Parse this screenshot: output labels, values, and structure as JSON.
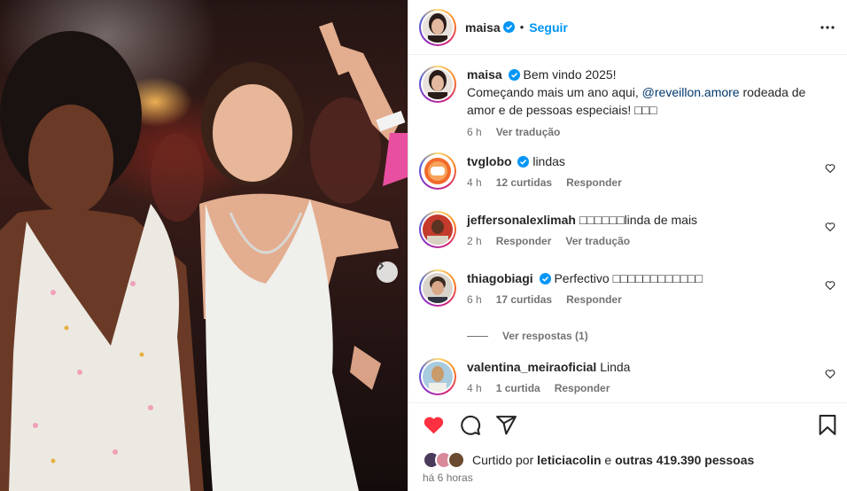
{
  "header": {
    "username": "maisa",
    "separator": "•",
    "follow_label": "Seguir"
  },
  "caption": {
    "username": "maisa",
    "line1": "Bem vindo 2025!",
    "line2_prefix": "Começando mais um ano aqui, ",
    "mention": "@reveillon.amore",
    "line2_suffix": " rodeada de amor e de pessoas especiais! □□□",
    "time": "6 h",
    "translate": "Ver tradução"
  },
  "comments": [
    {
      "username": "tvglobo",
      "verified": true,
      "text": "lindas",
      "time": "4 h",
      "likes": "12 curtidas",
      "reply": "Responder",
      "translate": ""
    },
    {
      "username": "jeffersonalexlimah",
      "verified": false,
      "text": "□□□□□□linda de mais",
      "time": "2 h",
      "likes": "",
      "reply": "Responder",
      "translate": "Ver tradução"
    },
    {
      "username": "thiagobiagi",
      "verified": true,
      "text": "Perfectivo □□□□□□□□□□□□",
      "time": "6 h",
      "likes": "17 curtidas",
      "reply": "Responder",
      "translate": ""
    },
    {
      "username": "valentina_meiraoficial",
      "verified": false,
      "text": "Linda",
      "time": "4 h",
      "likes": "1 curtida",
      "reply": "Responder",
      "translate": ""
    }
  ],
  "view_replies": "Ver respostas (1)",
  "likes": {
    "prefix": "Curtido por ",
    "user": "leticiacolin",
    "middle": " e ",
    "others": "outras 419.390 pessoas"
  },
  "post_time": "há 6 horas",
  "colors": {
    "like_red": "#ff3040",
    "link_blue": "#0095f6",
    "verified_blue": "#0095f6",
    "muted": "#737373"
  },
  "icons": [
    "verified-badge-icon",
    "more-options-icon",
    "heart-icon",
    "comment-icon",
    "share-icon",
    "bookmark-icon",
    "chevron-right-icon"
  ]
}
